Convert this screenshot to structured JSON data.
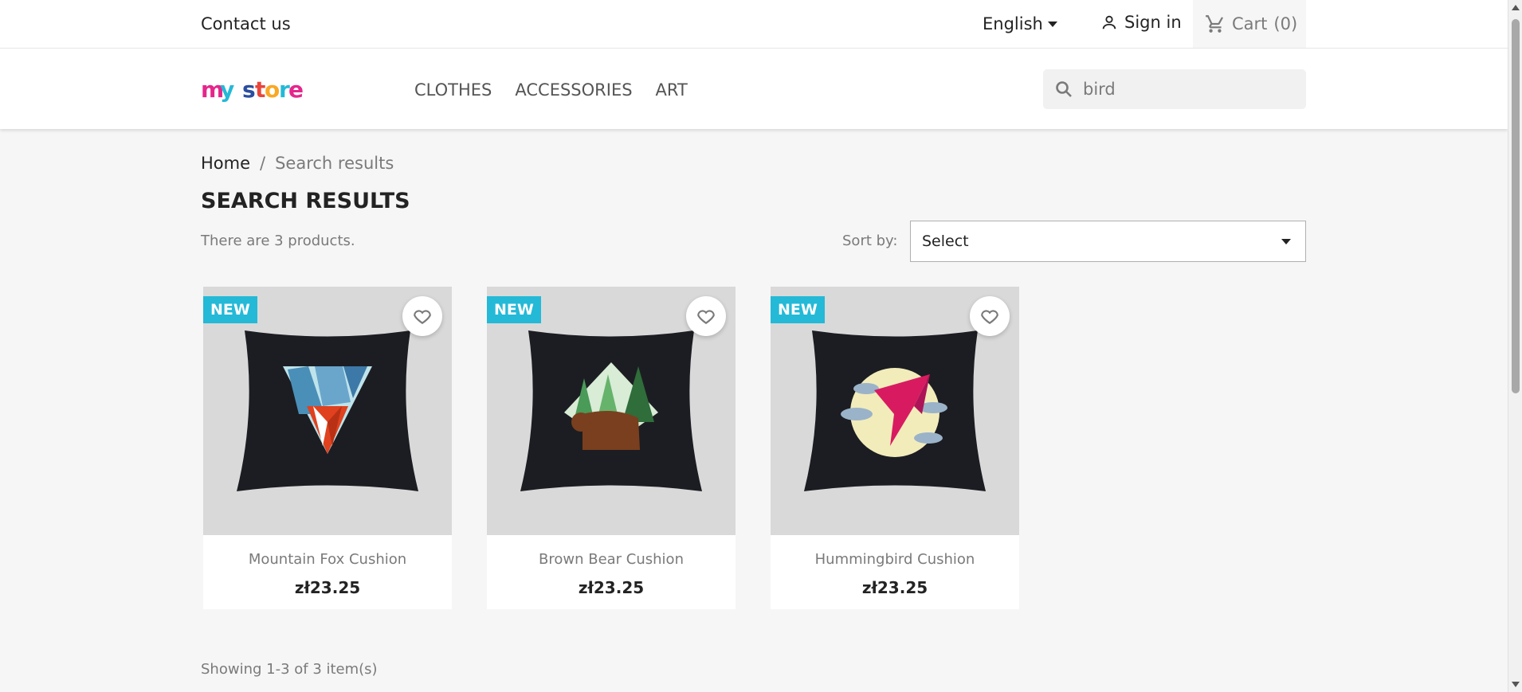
{
  "topbar": {
    "contact_label": "Contact us",
    "language": "English",
    "signin_label": "Sign in",
    "cart_label": "Cart",
    "cart_count": "(0)"
  },
  "header": {
    "logo_text": "my store",
    "nav": [
      {
        "label": "CLOTHES"
      },
      {
        "label": "ACCESSORIES"
      },
      {
        "label": "ART"
      }
    ],
    "search_value": "bird"
  },
  "breadcrumb": {
    "home": "Home",
    "separator": "/",
    "current": "Search results"
  },
  "main": {
    "title": "SEARCH RESULTS",
    "count_text": "There are 3 products.",
    "sort_label": "Sort by:",
    "sort_value": "Select",
    "showing_text": "Showing 1-3 of 3 item(s)"
  },
  "products": [
    {
      "badge": "NEW",
      "name": "Mountain Fox Cushion",
      "price": "zł23.25",
      "icon": "fox-cushion-image"
    },
    {
      "badge": "NEW",
      "name": "Brown Bear Cushion",
      "price": "zł23.25",
      "icon": "bear-cushion-image"
    },
    {
      "badge": "NEW",
      "name": "Hummingbird Cushion",
      "price": "zł23.25",
      "icon": "hummingbird-cushion-image"
    }
  ],
  "colors": {
    "badge": "#24b9d7",
    "text": "#232323",
    "muted": "#7a7a7a",
    "background": "#f6f6f6"
  }
}
